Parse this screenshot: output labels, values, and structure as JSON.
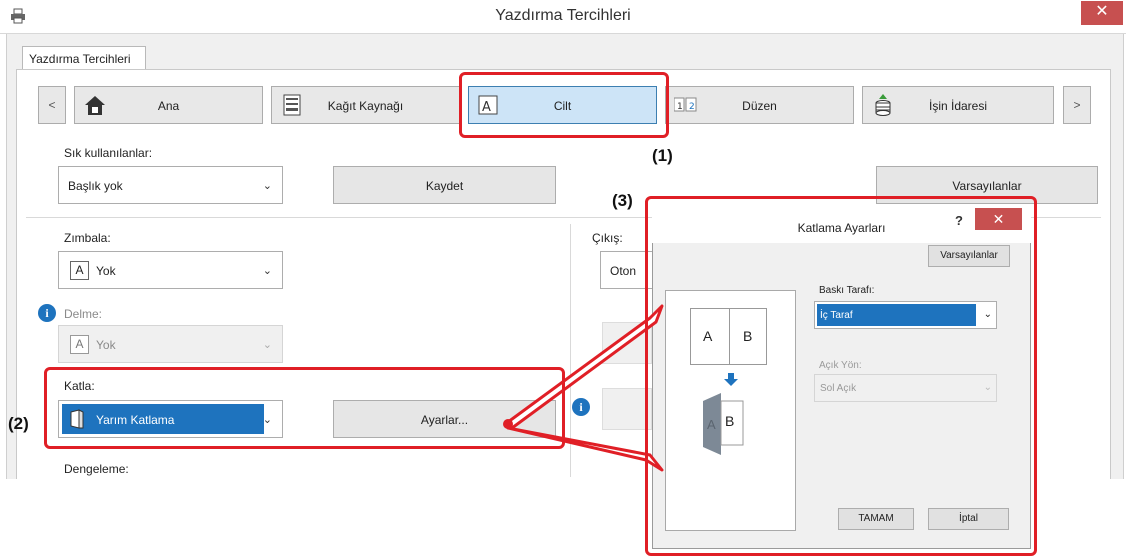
{
  "window": {
    "title": "Yazdırma Tercihleri",
    "close_glyph": "✕"
  },
  "tab_label": "Yazdırma Tercihleri",
  "nav": {
    "prev": "<",
    "next": ">",
    "items": [
      {
        "label": "Ana",
        "icon": "home-icon"
      },
      {
        "label": "Kağıt Kaynağı",
        "icon": "paper-tray-icon"
      },
      {
        "label": "Cilt",
        "icon": "binding-icon"
      },
      {
        "label": "Düzen",
        "icon": "layout-icon"
      },
      {
        "label": "İşin İdaresi",
        "icon": "job-handling-icon"
      }
    ]
  },
  "favorites": {
    "label": "Sık kullanılanlar:",
    "value": "Başlık yok",
    "save_label": "Kaydet",
    "defaults_label": "Varsayılanlar"
  },
  "staple": {
    "label": "Zımbala:",
    "value": "Yok"
  },
  "punch": {
    "label": "Delme:",
    "value": "Yok"
  },
  "fold": {
    "label": "Katla:",
    "value": "Yarım Katlama",
    "settings_label": "Ayarlar..."
  },
  "offset": {
    "label": "Dengeleme:"
  },
  "output": {
    "label": "Çıkış:",
    "value": "Oton"
  },
  "callouts": {
    "c1": "(1)",
    "c2": "(2)",
    "c3": "(3)"
  },
  "dialog": {
    "title": "Katlama Ayarları",
    "help": "?",
    "close_glyph": "✕",
    "defaults_label": "Varsayılanlar",
    "print_side_label": "Baskı Tarafı:",
    "print_side_value": "İç Taraf",
    "open_dir_label": "Açık Yön:",
    "open_dir_value": "Sol Açık",
    "ok_label": "TAMAM",
    "cancel_label": "İptal",
    "preview": {
      "page_a": "A",
      "page_b": "B",
      "folded_b": "B",
      "folded_a": "A"
    }
  },
  "colors": {
    "highlight": "#e01f26",
    "selection": "#1e73be",
    "close": "#c75050"
  }
}
